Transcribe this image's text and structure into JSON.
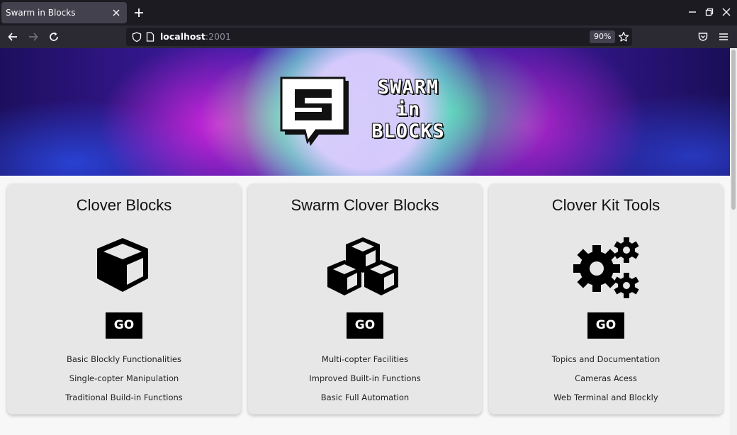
{
  "browser": {
    "tab_title": "Swarm in Blocks",
    "url_host": "localhost",
    "url_port": ":2001",
    "zoom": "90%"
  },
  "hero": {
    "logo_lines": [
      "SWARM",
      "in",
      "BLOCKS"
    ]
  },
  "cards": [
    {
      "title": "Clover Blocks",
      "icon": "cube-icon",
      "button": "GO",
      "features": [
        "Basic Blockly Functionalities",
        "Single-copter Manipulation",
        "Traditional Build-in Functions"
      ]
    },
    {
      "title": "Swarm Clover Blocks",
      "icon": "cubes-icon",
      "button": "GO",
      "features": [
        "Multi-copter Facilities",
        "Improved Built-in Functions",
        "Basic Full Automation"
      ]
    },
    {
      "title": "Clover Kit Tools",
      "icon": "gears-icon",
      "button": "GO",
      "features": [
        "Topics and Documentation",
        "Cameras Acess",
        "Web Terminal and Blockly"
      ]
    }
  ]
}
